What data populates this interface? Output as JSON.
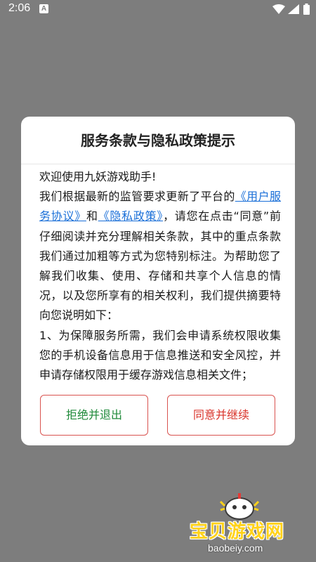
{
  "status_bar": {
    "time": "2:06",
    "notification_icon": "A"
  },
  "dialog": {
    "title": "服务条款与隐私政策提示",
    "body": {
      "greeting": "欢迎使用九妖游戏助手!",
      "text_before_links": "我们根据最新的监管要求更新了平台的",
      "link_user_agreement": "《用户服务协议》",
      "and": "和",
      "link_privacy_policy": "《隐私政策》",
      "text_after_links": "，请您在点击“同意”前仔细阅读并充分理解相关条款，其中的重点条款我们通过加粗等方式为您特别标注。为帮助您了解我们收集、使用、存储和共享个人信息的情况，以及您所享有的相关权利，我们提供摘要特向您说明如下：",
      "item1": "1、为保障服务所需，我们会申请系统权限收集您的手机设备信息用于信息推送和安全风控，并申请存储权限用于缓存游戏信息相关文件；"
    },
    "reject_button": "拒绝并退出",
    "agree_button": "同意并继续"
  },
  "watermark": {
    "brand": "宝贝游戏网",
    "domain": "baobeiy.com"
  },
  "colors": {
    "backdrop": "#7d7d7d",
    "link": "#1a6fd8",
    "reject_text": "#1f8a3a",
    "agree_text": "#d9342b",
    "button_border": "#d9534f"
  }
}
